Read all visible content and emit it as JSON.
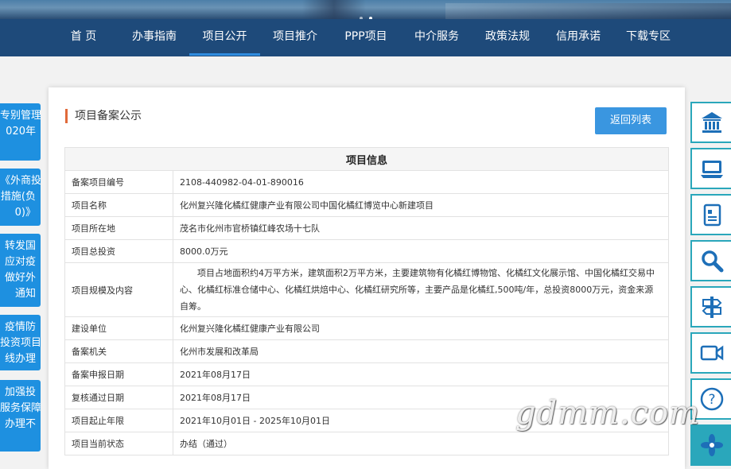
{
  "nav": {
    "items": [
      "首 页",
      "办事指南",
      "项目公开",
      "项目推介",
      "PPP项目",
      "中介服务",
      "政策法规",
      "信用承诺",
      "下载专区"
    ],
    "active_index": 2
  },
  "left_links": [
    [
      "专别管理",
      "020年"
    ],
    [
      "《外商投",
      "措施(负",
      "0)》"
    ],
    [
      "转发国",
      "应对疫",
      "做好外",
      "通知"
    ],
    [
      "疫情防",
      "投资项目",
      "线办理"
    ],
    [
      "加强投",
      "服务保障",
      "办理不"
    ]
  ],
  "section": {
    "title": "项目备案公示",
    "back_button": "返回列表"
  },
  "table": {
    "header": "项目信息",
    "rows": [
      {
        "key": "备案项目编号",
        "value": "2108-440982-04-01-890016"
      },
      {
        "key": "项目名称",
        "value": "化州复兴隆化橘红健康产业有限公司中国化橘红博览中心新建项目"
      },
      {
        "key": "项目所在地",
        "value": "茂名市化州市官桥镇红峰农场十七队"
      },
      {
        "key": "项目总投资",
        "value": "8000.0万元"
      },
      {
        "key": "项目规模及内容",
        "value": "项目占地面积约4万平方米，建筑面积2万平方米，主要建筑物有化橘红博物馆、化橘红文化展示馆、中国化橘红交易中心、化橘红标准仓储中心、化橘红烘焙中心、化橘红研究所等，主要产品是化橘红,500吨/年，总投资8000万元，资金来源自筹。"
      },
      {
        "key": "建设单位",
        "value": "化州复兴隆化橘红健康产业有限公司"
      },
      {
        "key": "备案机关",
        "value": "化州市发展和改革局"
      },
      {
        "key": "备案申报日期",
        "value": "2021年08月17日"
      },
      {
        "key": "复核通过日期",
        "value": "2021年08月17日"
      },
      {
        "key": "项目起止年限",
        "value": "2021年10月01日 - 2025年10月01日"
      },
      {
        "key": "项目当前状态",
        "value": "办结（通过）"
      }
    ]
  },
  "right_icons": [
    "government-building-icon",
    "computer-icon",
    "document-icon",
    "search-icon",
    "signpost-icon",
    "video-icon",
    "help-icon",
    "logo-icon"
  ],
  "watermark": "gdmm.com",
  "colors": {
    "nav_bg": "#1e4a7a",
    "accent": "#3a96e0",
    "title_bar": "#e06a3a",
    "icon_border": "#2aa7bb"
  }
}
